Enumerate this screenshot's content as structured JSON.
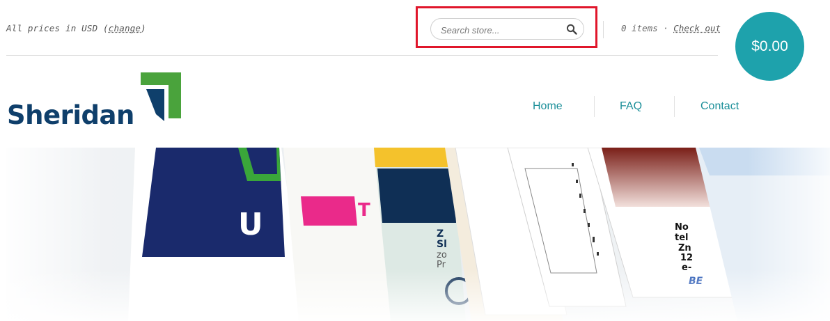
{
  "topbar": {
    "prices_prefix": "All prices in USD (",
    "prices_change": "change",
    "prices_suffix": ")",
    "search_placeholder": "Search store...",
    "cart_items": "0 items",
    "cart_separator": " · ",
    "checkout_label": "Check out",
    "cart_total": "$0.00"
  },
  "logo": {
    "text": "Sheridan"
  },
  "nav": {
    "items": [
      {
        "label": "Home"
      },
      {
        "label": "FAQ"
      },
      {
        "label": "Contact"
      }
    ]
  },
  "hero": {
    "visible_text": [
      "U",
      "T",
      "Z",
      "Sl",
      "zo",
      "Pr",
      "No",
      "tel",
      "Zn",
      "12",
      "e-",
      "BE"
    ]
  },
  "colors": {
    "accent": "#1ea2ac",
    "brand_navy": "#0f3f6b",
    "brand_green": "#4aa33c",
    "highlight_box": "#e0162b",
    "nav_link": "#1b8f99"
  },
  "icons": {
    "search": "magnifier-icon",
    "logo_mark": "folded-corner-logo-mark"
  }
}
